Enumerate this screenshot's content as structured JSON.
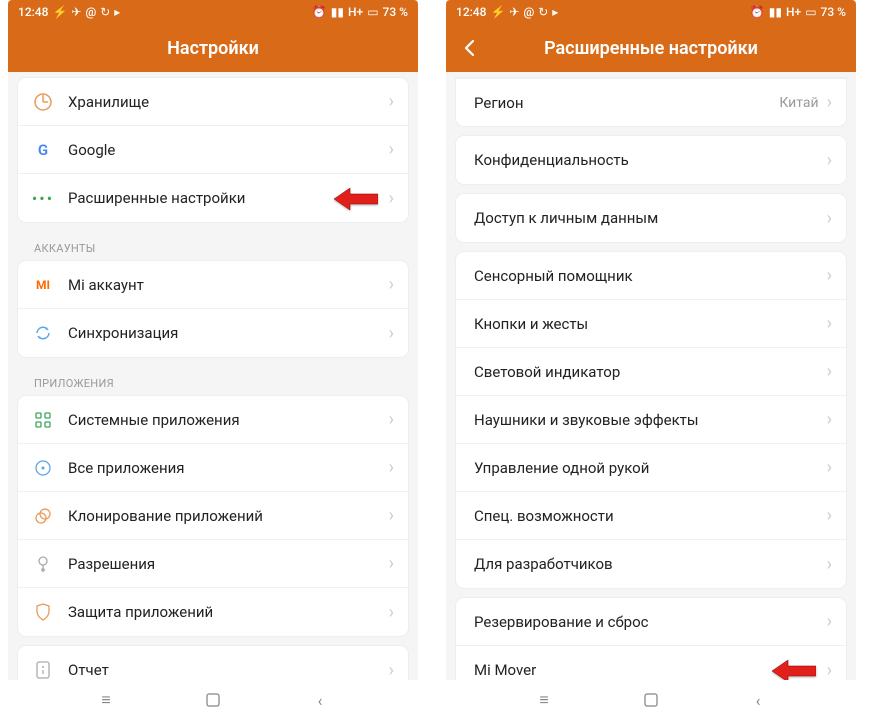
{
  "status": {
    "time": "12:48",
    "network": "H+",
    "battery": "73 %"
  },
  "left": {
    "title": "Настройки",
    "group1": [
      {
        "icon": "storage-icon",
        "label": "Хранилище"
      },
      {
        "icon": "google-icon",
        "label": "Google"
      },
      {
        "icon": "dots-icon",
        "label": "Расширенные настройки",
        "arrow": true
      }
    ],
    "section_accounts": "АККАУНТЫ",
    "group2": [
      {
        "icon": "mi-icon",
        "label": "Mi аккаунт"
      },
      {
        "icon": "sync-icon",
        "label": "Синхронизация"
      }
    ],
    "section_apps": "ПРИЛОЖЕНИЯ",
    "group3": [
      {
        "icon": "apps-icon",
        "label": "Системные приложения"
      },
      {
        "icon": "circle-icon",
        "label": "Все приложения"
      },
      {
        "icon": "clone-icon",
        "label": "Клонирование приложений"
      },
      {
        "icon": "perm-icon",
        "label": "Разрешения"
      },
      {
        "icon": "shield-icon",
        "label": "Защита приложений"
      }
    ],
    "group4": [
      {
        "icon": "report-icon",
        "label": "Отчет"
      }
    ]
  },
  "right": {
    "title": "Расширенные настройки",
    "group1": [
      {
        "label": "Регион",
        "value": "Китай"
      }
    ],
    "group2": [
      {
        "label": "Конфиденциальность"
      }
    ],
    "group3": [
      {
        "label": "Доступ к личным данным"
      }
    ],
    "group4": [
      {
        "label": "Сенсорный помощник"
      },
      {
        "label": "Кнопки и жесты"
      },
      {
        "label": "Световой индикатор"
      },
      {
        "label": "Наушники и звуковые эффекты"
      },
      {
        "label": "Управление одной рукой"
      },
      {
        "label": "Спец. возможности"
      },
      {
        "label": "Для разработчиков"
      }
    ],
    "group5": [
      {
        "label": "Резервирование и сброс"
      },
      {
        "label": "Mi Mover",
        "arrow": true
      }
    ]
  }
}
